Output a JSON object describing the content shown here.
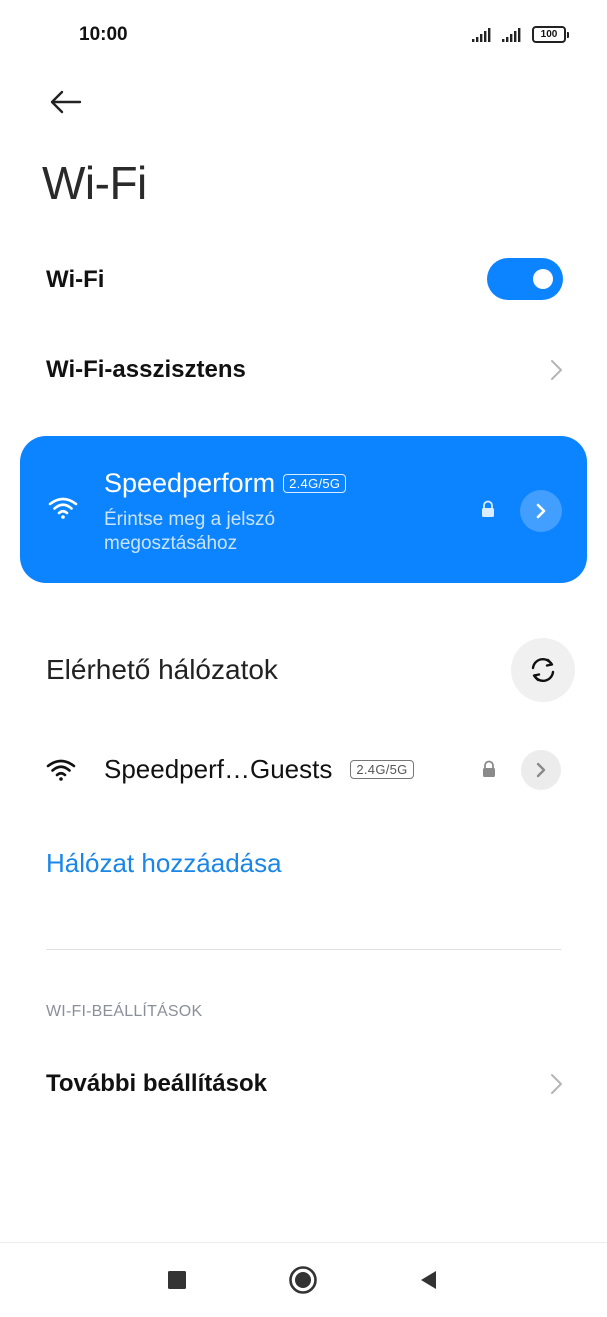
{
  "status_bar": {
    "time": "10:00",
    "battery": "100"
  },
  "header": {
    "back_icon": "arrow-left-icon",
    "title": "Wi-Fi"
  },
  "wifi_toggle": {
    "label": "Wi-Fi",
    "enabled": true
  },
  "assistant": {
    "label": "Wi-Fi-asszisztens"
  },
  "connected_network": {
    "name": "Speedperform",
    "band": "2.4G/5G",
    "subtitle": "Érintse meg a jelszó megosztásához",
    "secured": true
  },
  "available": {
    "title": "Elérhető hálózatok",
    "refresh_icon": "refresh-icon",
    "networks": [
      {
        "name": "Speedperf…Guests",
        "band": "2.4G/5G",
        "secured": true
      }
    ]
  },
  "add_network": {
    "label": "Hálózat hozzáadása"
  },
  "settings": {
    "header": "WI-FI-BEÁLLÍTÁSOK",
    "more_label": "További beállítások"
  },
  "nav": {
    "recents_icon": "square-icon",
    "home_icon": "circle-home-icon",
    "back_icon": "triangle-back-icon"
  },
  "colors": {
    "accent": "#0d84ff",
    "link": "#1a86e8",
    "section_header": "#8a8f99"
  }
}
